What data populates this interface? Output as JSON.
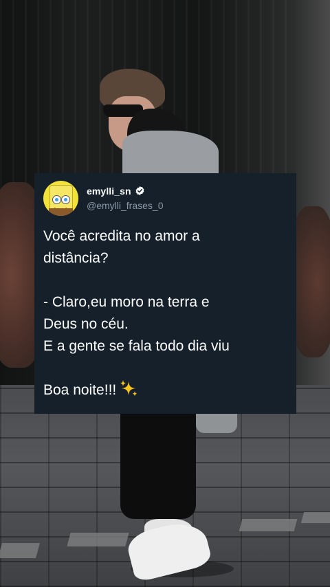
{
  "tweet": {
    "display_name": "emylli_sn",
    "handle": "@emylli_frases_0",
    "verified": true,
    "avatar": "spongebob-avatar",
    "text": {
      "line1": "Você acredita no amor a",
      "line2": "distância?",
      "line3": "- Claro,eu moro na terra e",
      "line4": "Deus no céu.",
      "line5": "E a gente se fala todo dia viu",
      "line6": "Boa noite!!!"
    },
    "emoji": "sparkles-emoji"
  },
  "colors": {
    "card_bg": "#15202b",
    "text_primary": "#ffffff",
    "text_secondary": "#8b98a5",
    "verified_badge": "#ffffff"
  }
}
